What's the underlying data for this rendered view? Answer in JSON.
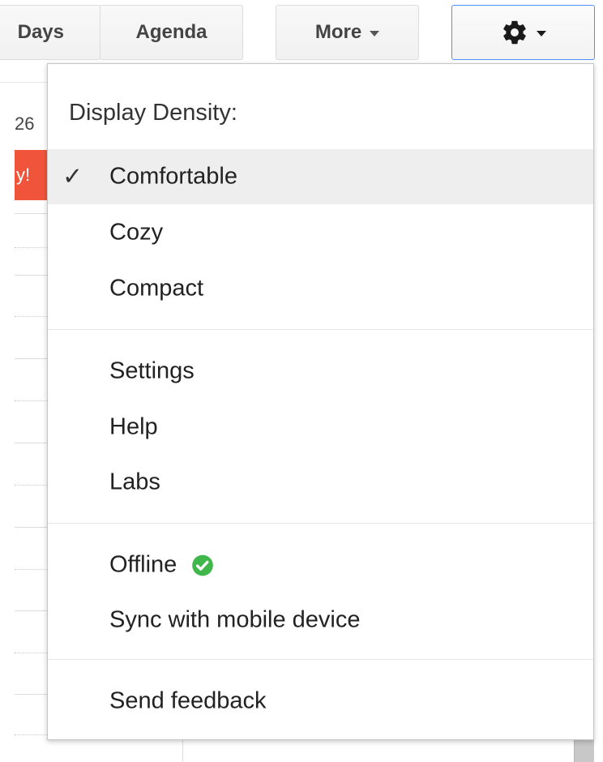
{
  "toolbar": {
    "days_label": "Days",
    "agenda_label": "Agenda",
    "more_label": "More"
  },
  "calendar": {
    "date_number": "26",
    "event_text": "y!",
    "event_color": "#f0553c"
  },
  "menu": {
    "heading": "Display Density:",
    "density_items": [
      {
        "label": "Comfortable",
        "selected": true
      },
      {
        "label": "Cozy",
        "selected": false
      },
      {
        "label": "Compact",
        "selected": false
      }
    ],
    "general_items": [
      {
        "label": "Settings"
      },
      {
        "label": "Help"
      },
      {
        "label": "Labs"
      }
    ],
    "offline_label": "Offline",
    "sync_label": "Sync with mobile device",
    "feedback_label": "Send feedback",
    "check_mark": "✓",
    "offline_status_color": "#3fb74a"
  },
  "colors": {
    "accent_border": "#4d90fe",
    "selected_row_bg": "#eeeeee"
  }
}
